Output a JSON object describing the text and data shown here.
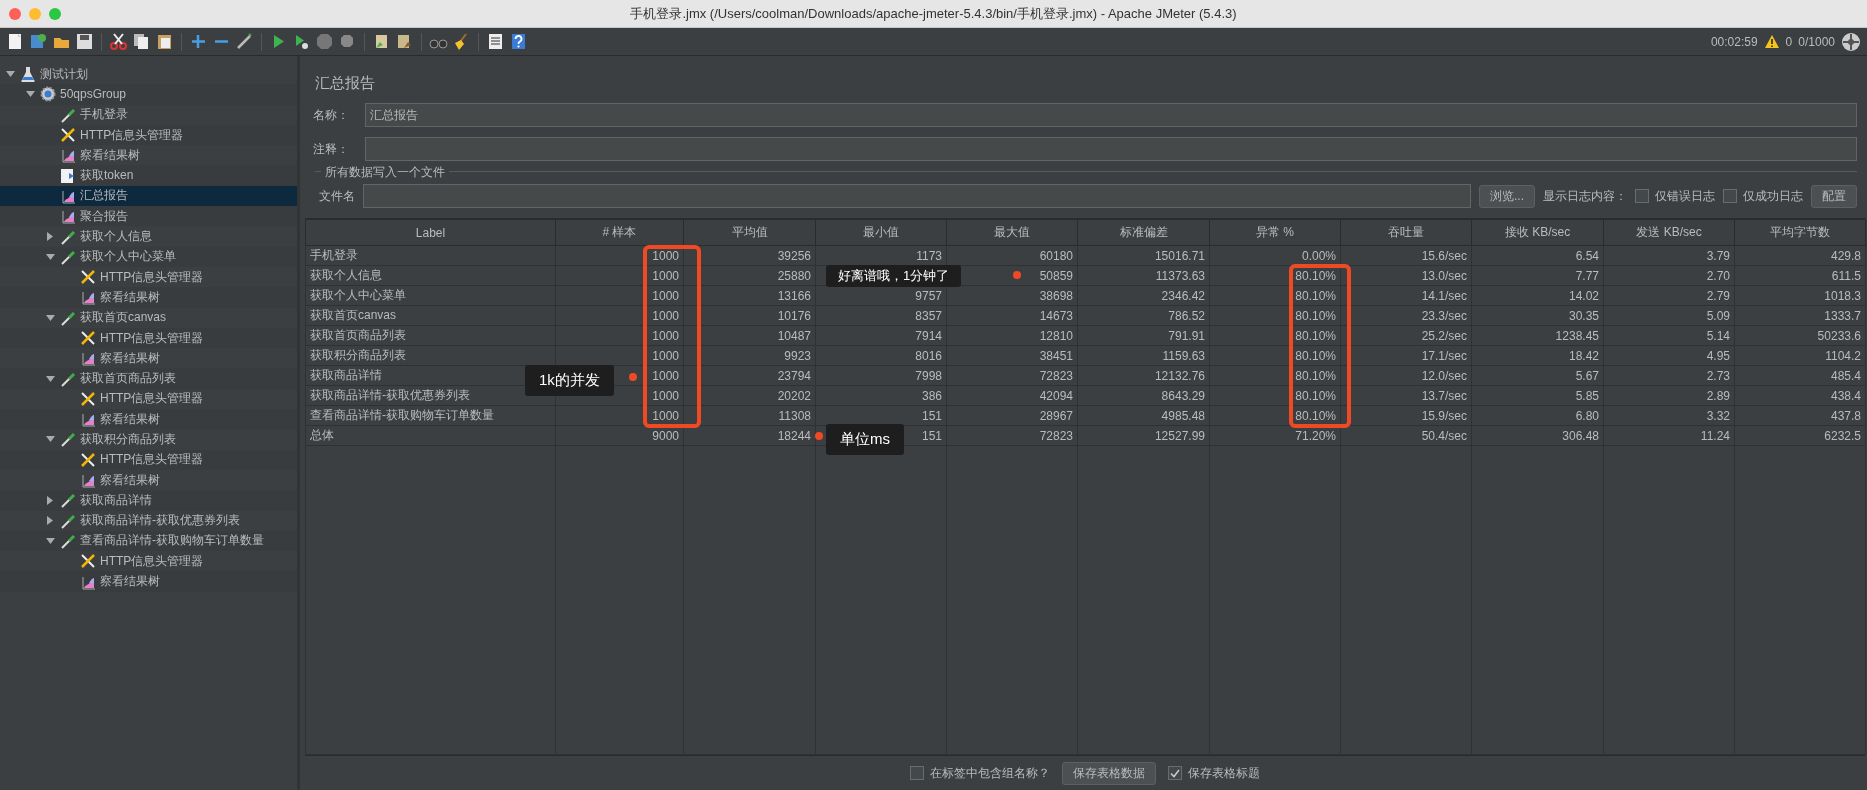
{
  "window": {
    "title": "手机登录.jmx (/Users/coolman/Downloads/apache-jmeter-5.4.3/bin/手机登录.jmx) - Apache JMeter (5.4.3)"
  },
  "toolbar": {
    "elapsed": "00:02:59",
    "warnings": "0",
    "threads": "0/1000"
  },
  "tree": [
    {
      "label": "测试计划",
      "kind": "plan",
      "expanded": true,
      "selected": false,
      "children": [
        {
          "label": "50qpsGroup",
          "kind": "group",
          "expanded": true,
          "selected": false,
          "children": [
            {
              "label": "手机登录",
              "kind": "sampler",
              "selected": false
            },
            {
              "label": "HTTP信息头管理器",
              "kind": "config",
              "selected": false
            },
            {
              "label": "察看结果树",
              "kind": "listener",
              "selected": false
            },
            {
              "label": "获取token",
              "kind": "processor",
              "selected": false
            },
            {
              "label": "汇总报告",
              "kind": "listener",
              "selected": true
            },
            {
              "label": "聚合报告",
              "kind": "listener",
              "selected": false
            },
            {
              "label": "获取个人信息",
              "kind": "sampler",
              "expanded": false,
              "selected": false
            },
            {
              "label": "获取个人中心菜单",
              "kind": "sampler",
              "expanded": true,
              "selected": false,
              "children": [
                {
                  "label": "HTTP信息头管理器",
                  "kind": "config",
                  "selected": false
                },
                {
                  "label": "察看结果树",
                  "kind": "listener",
                  "selected": false
                }
              ]
            },
            {
              "label": "获取首页canvas",
              "kind": "sampler",
              "expanded": true,
              "selected": false,
              "children": [
                {
                  "label": "HTTP信息头管理器",
                  "kind": "config",
                  "selected": false
                },
                {
                  "label": "察看结果树",
                  "kind": "listener",
                  "selected": false
                }
              ]
            },
            {
              "label": "获取首页商品列表",
              "kind": "sampler",
              "expanded": true,
              "selected": false,
              "children": [
                {
                  "label": "HTTP信息头管理器",
                  "kind": "config",
                  "selected": false
                },
                {
                  "label": "察看结果树",
                  "kind": "listener",
                  "selected": false
                }
              ]
            },
            {
              "label": "获取积分商品列表",
              "kind": "sampler",
              "expanded": true,
              "selected": false,
              "children": [
                {
                  "label": "HTTP信息头管理器",
                  "kind": "config",
                  "selected": false
                },
                {
                  "label": "察看结果树",
                  "kind": "listener",
                  "selected": false
                }
              ]
            },
            {
              "label": "获取商品详情",
              "kind": "sampler",
              "expanded": false,
              "selected": false
            },
            {
              "label": "获取商品详情-获取优惠券列表",
              "kind": "sampler",
              "expanded": false,
              "selected": false
            },
            {
              "label": "查看商品详情-获取购物车订单数量",
              "kind": "sampler",
              "expanded": true,
              "selected": false,
              "children": [
                {
                  "label": "HTTP信息头管理器",
                  "kind": "config",
                  "selected": false
                },
                {
                  "label": "察看结果树",
                  "kind": "listener",
                  "selected": false
                }
              ]
            }
          ]
        }
      ]
    }
  ],
  "panel": {
    "title": "汇总报告",
    "name_label": "名称：",
    "name_value": "汇总报告",
    "comment_label": "注释：",
    "file_section": "所有数据写入一个文件",
    "file_label": "文件名",
    "browse_button": "浏览...",
    "log_label": "显示日志内容：",
    "options": [
      {
        "label": "仅错误日志",
        "checked": false
      },
      {
        "label": "仅成功日志",
        "checked": false
      }
    ],
    "config_button": "配置"
  },
  "table": {
    "columns": [
      "Label",
      "# 样本",
      "平均值",
      "最小值",
      "最大值",
      "标准偏差",
      "异常 %",
      "吞吐量",
      "接收 KB/sec",
      "发送 KB/sec",
      "平均字节数"
    ],
    "rows": [
      [
        "手机登录",
        "1000",
        "39256",
        "1173",
        "60180",
        "15016.71",
        "0.00%",
        "15.6/sec",
        "6.54",
        "3.79",
        "429.8"
      ],
      [
        "获取个人信息",
        "1000",
        "25880",
        null,
        "50859",
        "11373.63",
        "80.10%",
        "13.0/sec",
        "7.77",
        "2.70",
        "611.5"
      ],
      [
        "获取个人中心菜单",
        "1000",
        "13166",
        "9757",
        "38698",
        "2346.42",
        "80.10%",
        "14.1/sec",
        "14.02",
        "2.79",
        "1018.3"
      ],
      [
        "获取首页canvas",
        "1000",
        "10176",
        "8357",
        "14673",
        "786.52",
        "80.10%",
        "23.3/sec",
        "30.35",
        "5.09",
        "1333.7"
      ],
      [
        "获取首页商品列表",
        "1000",
        "10487",
        "7914",
        "12810",
        "791.91",
        "80.10%",
        "25.2/sec",
        "1238.45",
        "5.14",
        "50233.6"
      ],
      [
        "获取积分商品列表",
        "1000",
        "9923",
        "8016",
        "38451",
        "1159.63",
        "80.10%",
        "17.1/sec",
        "18.42",
        "4.95",
        "1104.2"
      ],
      [
        "获取商品详情",
        "1000",
        "23794",
        "7998",
        "72823",
        "12132.76",
        "80.10%",
        "12.0/sec",
        "5.67",
        "2.73",
        "485.4"
      ],
      [
        "获取商品详情-获取优惠券列表",
        "1000",
        "20202",
        "386",
        "42094",
        "8643.29",
        "80.10%",
        "13.7/sec",
        "5.85",
        "2.89",
        "438.4"
      ],
      [
        "查看商品详情-获取购物车订单数量",
        "1000",
        "11308",
        "151",
        "28967",
        "4985.48",
        "80.10%",
        "15.9/sec",
        "6.80",
        "3.32",
        "437.8"
      ],
      [
        "总体",
        "9000",
        "18244",
        "151",
        "72823",
        "12527.99",
        "71.20%",
        "50.4/sec",
        "306.48",
        "11.24",
        "6232.5"
      ]
    ]
  },
  "footer": [
    {
      "kind": "checkbox",
      "label": "在标签中包含组名称？",
      "checked": false
    },
    {
      "kind": "button",
      "label": "保存表格数据"
    },
    {
      "kind": "checkbox",
      "label": "保存表格标题",
      "checked": true
    }
  ],
  "annotations": [
    "好离谱哦，1分钟了",
    "1k的并发",
    "单位ms"
  ]
}
